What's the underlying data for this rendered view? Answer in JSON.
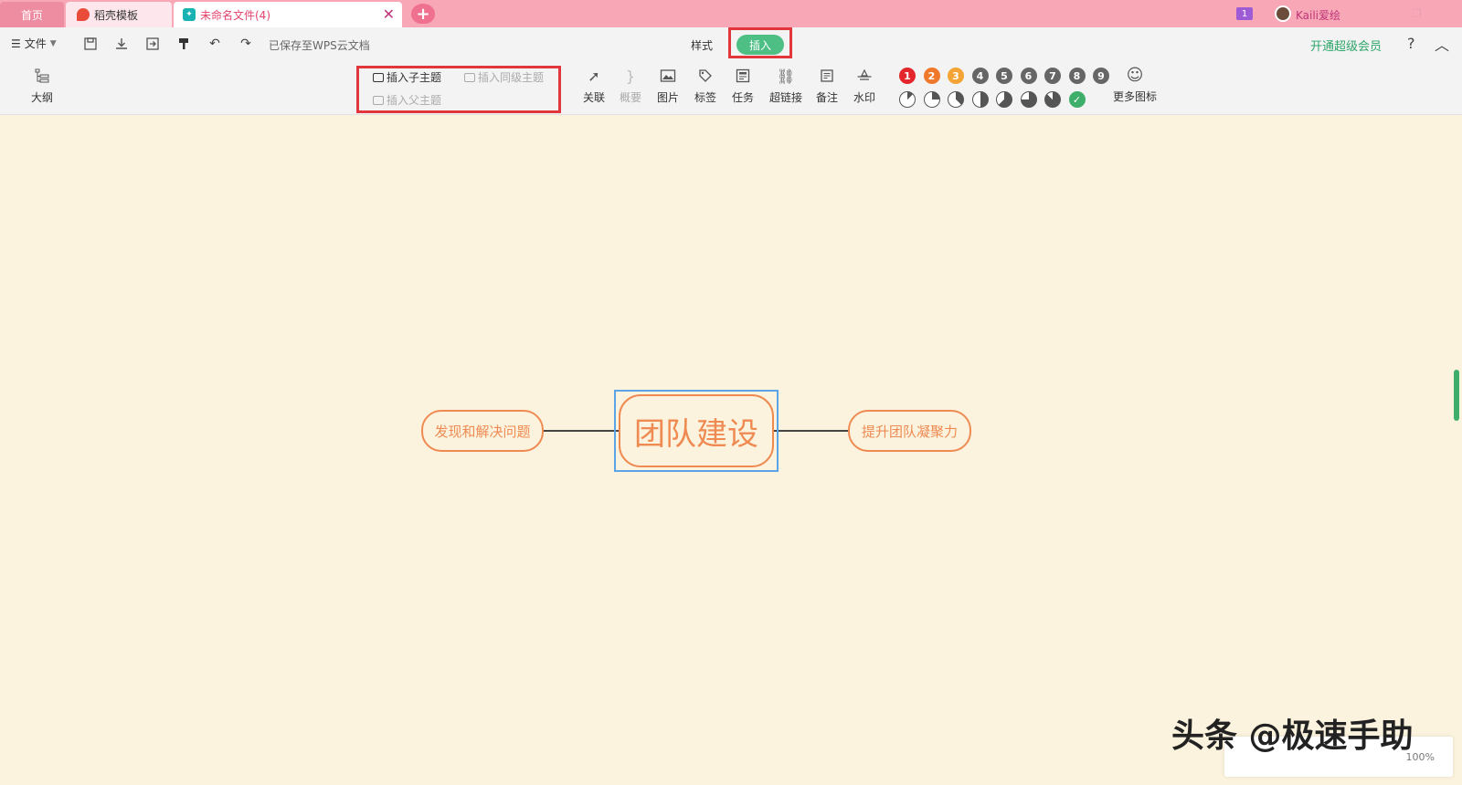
{
  "tabs": {
    "home": "首页",
    "template": "稻壳模板",
    "document": "未命名文件(4)"
  },
  "topbar": {
    "badge": "1",
    "username": "Kaili爱绘"
  },
  "menu": {
    "file": "文件",
    "saved_status": "已保存至WPS云文档",
    "tab_style": "样式",
    "tab_insert": "插入",
    "vip": "开通超级会员",
    "help": "?"
  },
  "ribbon": {
    "outline": "大纲",
    "insert_child": "插入子主题",
    "insert_sibling": "插入同级主题",
    "insert_parent": "插入父主题",
    "relation": "关联",
    "summary": "概要",
    "image": "图片",
    "tag": "标签",
    "task": "任务",
    "hyperlink": "超链接",
    "note": "备注",
    "watermark": "水印",
    "more_icons": "更多图标",
    "priorities": [
      "1",
      "2",
      "3",
      "4",
      "5",
      "6",
      "7",
      "8",
      "9"
    ],
    "priority_colors": [
      "#e3262b",
      "#f0782a",
      "#f3a435",
      "#666666",
      "#666666",
      "#666666",
      "#666666",
      "#666666",
      "#666666"
    ],
    "progress_icons": [
      "progress-1-8-icon",
      "progress-1-4-icon",
      "progress-3-8-icon",
      "progress-1-2-icon",
      "progress-5-8-icon",
      "progress-3-4-icon",
      "progress-7-8-icon",
      "progress-done-icon"
    ]
  },
  "mindmap": {
    "center": "团队建设",
    "left": "发现和解决问题",
    "right": "提升团队凝聚力",
    "accent_color": "#ef8a52"
  },
  "status": {
    "zoom": "100%"
  },
  "watermark_text": "头条 @极速手助"
}
